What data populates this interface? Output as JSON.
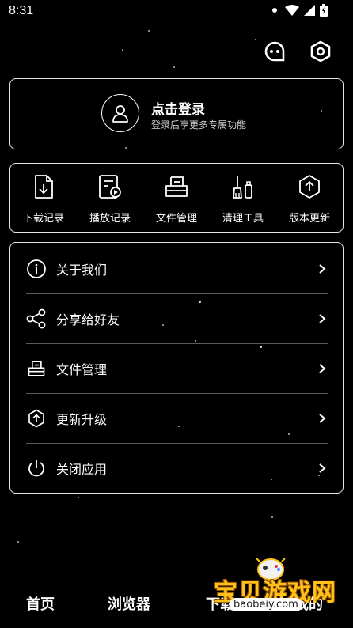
{
  "status_bar": {
    "time": "8:31"
  },
  "header": {
    "icons": [
      "chat-face-icon",
      "settings-hex-icon"
    ]
  },
  "login": {
    "title": "点击登录",
    "subtitle": "登录后享更多专属功能"
  },
  "tools": [
    {
      "label": "下载记录",
      "icon": "download-doc-icon"
    },
    {
      "label": "播放记录",
      "icon": "play-record-icon"
    },
    {
      "label": "文件管理",
      "icon": "file-manager-icon"
    },
    {
      "label": "清理工具",
      "icon": "broom-icon"
    },
    {
      "label": "版本更新",
      "icon": "update-icon"
    }
  ],
  "menu": [
    {
      "label": "关于我们",
      "icon": "info-icon"
    },
    {
      "label": "分享给好友",
      "icon": "share-icon"
    },
    {
      "label": "文件管理",
      "icon": "file-manager-icon"
    },
    {
      "label": "更新升级",
      "icon": "update-icon"
    },
    {
      "label": "关闭应用",
      "icon": "power-icon"
    }
  ],
  "nav": [
    {
      "label": "首页"
    },
    {
      "label": "浏览器"
    },
    {
      "label": "下载"
    },
    {
      "label": "我的"
    }
  ],
  "watermark": {
    "text": "宝贝游戏网",
    "url": "baobeiy.com"
  },
  "colors": {
    "background": "#000000",
    "border": "#e6e6e6",
    "watermark": "#ffc21a"
  }
}
